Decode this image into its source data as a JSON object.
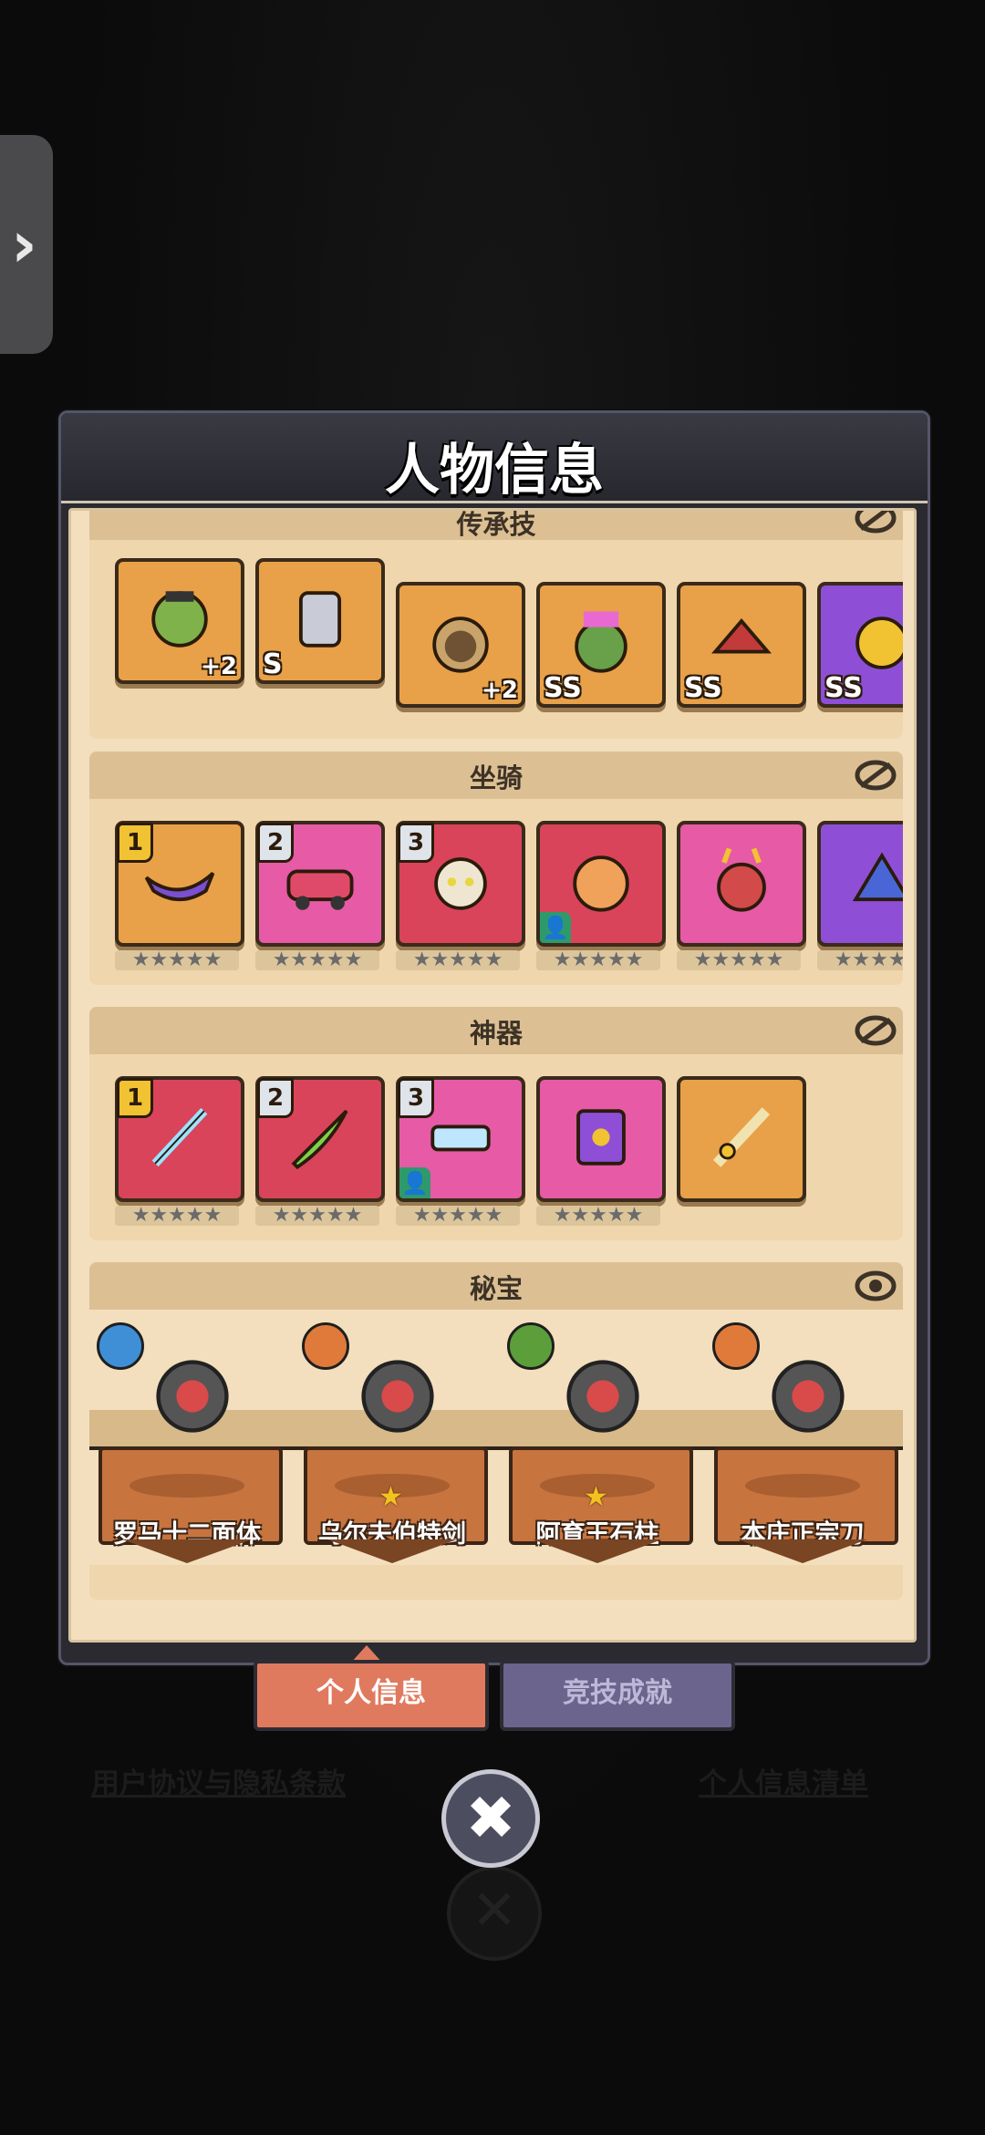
{
  "panel": {
    "title": "人物信息"
  },
  "sections": {
    "legacy": {
      "title": "传承技",
      "cards": [
        {
          "art": "orc-hero",
          "rank": "",
          "plus": "+2",
          "color": "#e8a148"
        },
        {
          "art": "knight-hero",
          "rank": "S",
          "plus": "",
          "color": "#e8a148"
        },
        {
          "art": "bear-hero",
          "rank": "",
          "plus": "+2",
          "color": "#e8a148"
        },
        {
          "art": "frog-hero",
          "rank": "SS",
          "plus": "",
          "color": "#e8a148"
        },
        {
          "art": "bird-hero",
          "rank": "SS",
          "plus": "",
          "color": "#e8a148"
        },
        {
          "art": "gold-hero",
          "rank": "SS",
          "plus": "",
          "color": "#8e4fd6"
        }
      ]
    },
    "mount": {
      "title": "坐骑",
      "cards": [
        {
          "art": "boat-mount",
          "badge": "1",
          "color": "#e8a148",
          "stars": "★★★★★"
        },
        {
          "art": "car-mount",
          "badge": "2",
          "color": "#e65aa6",
          "stars": "★★★★★"
        },
        {
          "art": "cat-mount",
          "badge": "3",
          "color": "#d9445a",
          "stars": "★★★★★"
        },
        {
          "art": "tiger-mount",
          "badge": "",
          "person": true,
          "color": "#d9445a",
          "stars": "★★★★★"
        },
        {
          "art": "deer-mount",
          "badge": "",
          "color": "#e65aa6",
          "stars": "★★★★★"
        },
        {
          "art": "dragon-mount",
          "badge": "",
          "color": "#8e4fd6",
          "stars": "★★★★★"
        }
      ]
    },
    "artifact": {
      "title": "神器",
      "cards": [
        {
          "art": "sword-artifact",
          "badge": "1",
          "color": "#d9445a",
          "stars": "★★★★★"
        },
        {
          "art": "blade-artifact",
          "badge": "2",
          "color": "#d9445a",
          "stars": "★★★★★"
        },
        {
          "art": "gun-artifact",
          "badge": "3",
          "person": true,
          "color": "#e65aa6",
          "stars": "★★★★★"
        },
        {
          "art": "book-artifact",
          "badge": "",
          "color": "#e65aa6",
          "stars": "★★★★★"
        },
        {
          "art": "gold-sword-artifact",
          "badge": "",
          "color": "#e8a148",
          "stars": ""
        }
      ]
    },
    "treasure": {
      "title": "秘宝",
      "items": [
        {
          "name": "罗马十二面体",
          "icon": "tree-icon",
          "icon_color": "#3f8fd6",
          "star": false
        },
        {
          "name": "乌尔夫伯特剑",
          "icon": "shield-icon",
          "icon_color": "#e07a3a",
          "star": true
        },
        {
          "name": "阿育王石柱",
          "icon": "sun-icon",
          "icon_color": "#5b9e3a",
          "star": true
        },
        {
          "name": "本庄正宗刀",
          "icon": "shield-icon",
          "icon_color": "#e07a3a",
          "star": false
        }
      ]
    }
  },
  "tabs": {
    "active": "个人信息",
    "inactive": "竞技成就"
  },
  "links": {
    "privacy": "用户协议与隐私条款",
    "personal_list": "个人信息清单"
  },
  "close": {
    "label": "✖"
  }
}
